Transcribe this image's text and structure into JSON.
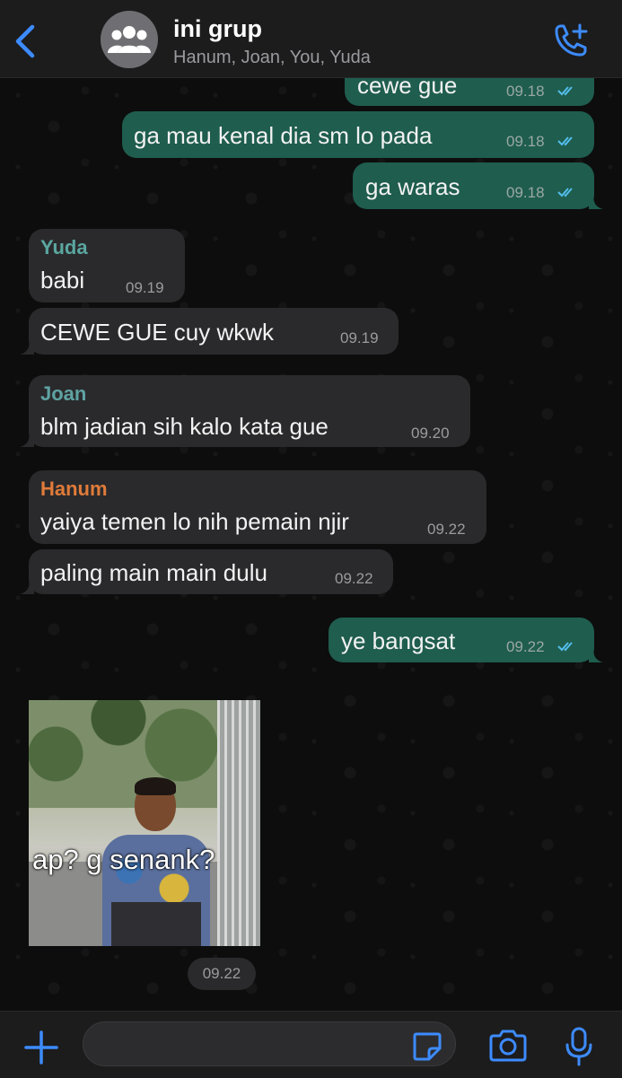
{
  "header": {
    "title": "ini grup",
    "subtitle": "Hanum, Joan, You, Yuda",
    "back_icon": "chevron-left-icon",
    "avatar_icon": "group-icon",
    "call_icon": "add-call-icon"
  },
  "colors": {
    "accent": "#3d8bfd",
    "outgoing_bubble": "#1f5d4e",
    "incoming_bubble": "#2a2a2c",
    "sender_yuda": "#5ba6a0",
    "sender_joan": "#5fa3a3",
    "sender_hanum": "#e07b3a",
    "read_ticks": "#53bdeb"
  },
  "messages": [
    {
      "direction": "out",
      "text": "cewe gue",
      "time": "09.18",
      "read": true
    },
    {
      "direction": "out",
      "text": "ga mau kenal dia sm lo pada",
      "time": "09.18",
      "read": true
    },
    {
      "direction": "out",
      "text": "ga waras",
      "time": "09.18",
      "read": true
    },
    {
      "direction": "in",
      "sender": "Yuda",
      "text": "babi",
      "time": "09.19"
    },
    {
      "direction": "in",
      "text": "CEWE GUE cuy wkwk",
      "time": "09.19"
    },
    {
      "direction": "in",
      "sender": "Joan",
      "text": "blm jadian sih kalo kata gue",
      "time": "09.20"
    },
    {
      "direction": "in",
      "sender": "Hanum",
      "text": "yaiya temen lo nih pemain njir",
      "time": "09.22"
    },
    {
      "direction": "in",
      "text": "paling main main dulu",
      "time": "09.22"
    },
    {
      "direction": "out",
      "text": "ye bangsat",
      "time": "09.22",
      "read": true
    }
  ],
  "image_message": {
    "caption": "ap? g senank?",
    "time": "09.22"
  },
  "footer": {
    "plus_icon": "plus-icon",
    "sticker_icon": "sticker-icon",
    "camera_icon": "camera-icon",
    "mic_icon": "microphone-icon"
  }
}
